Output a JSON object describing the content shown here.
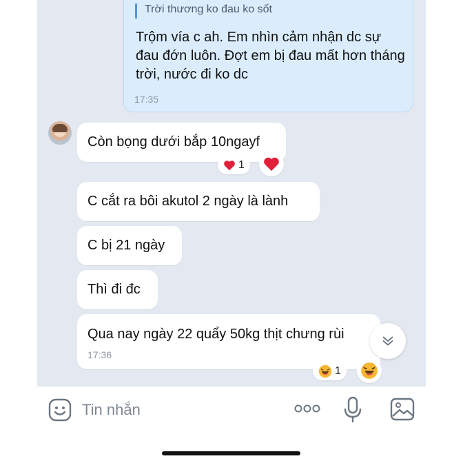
{
  "outgoing": {
    "quote": "Trời thương ko đau ko sốt",
    "text": "Trộm vía c ah. Em nhìn cảm nhận dc sự đau đớn luôn. Đợt em bị đau mất hơn tháng trời, nước đi ko dc",
    "time": "17:35"
  },
  "incoming": [
    {
      "text": "Còn bọng dưới bắp 10ngayf"
    },
    {
      "text": "C cắt ra bôi akutol 2 ngày là lành"
    },
    {
      "text": "C bị 21 ngày"
    },
    {
      "text": "Thì đi đc"
    },
    {
      "text": "Qua nay ngày 22 quẩy 50kg thịt chưng rùi",
      "time": "17:36"
    }
  ],
  "reactions": [
    {
      "emoji": "heart",
      "count": "1"
    },
    {
      "emoji": "laughing-face",
      "count": "1"
    }
  ],
  "input": {
    "placeholder": "Tin nhắn"
  },
  "colors": {
    "chat_bg": "#e3e8f1",
    "outgoing_bg": "#dbedfd",
    "accent": "#4f96d8",
    "heart": "#e0203a"
  }
}
